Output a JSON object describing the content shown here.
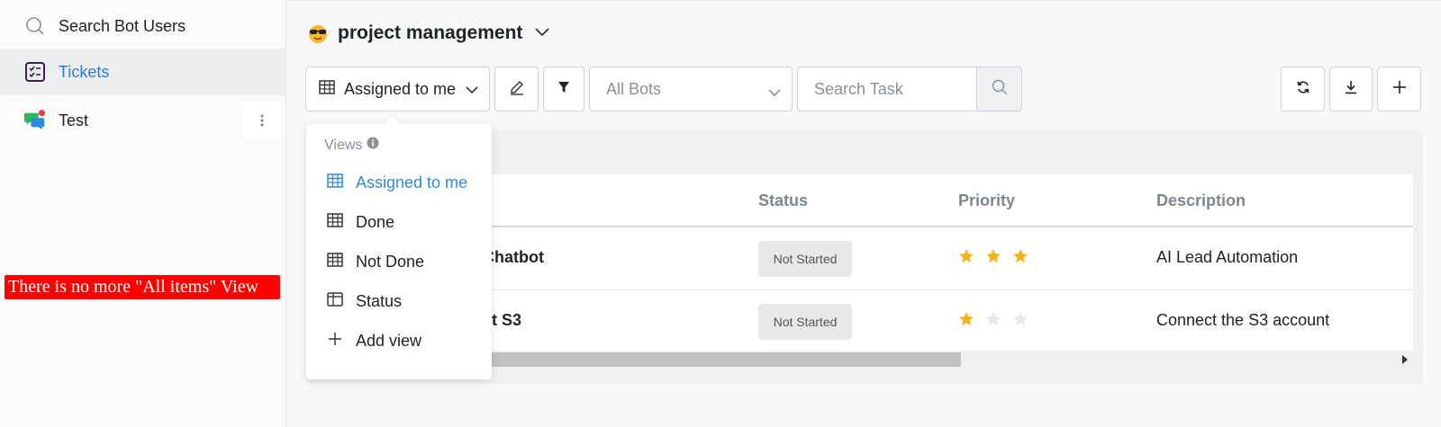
{
  "sidebar": {
    "search_label": "Search Bot Users",
    "tickets_label": "Tickets",
    "test_label": "Test"
  },
  "annotation": "There is no more \"All items\" View",
  "header": {
    "project_title": "project management"
  },
  "toolbar": {
    "view_label": "Assigned to me",
    "bots_label": "All Bots",
    "search_placeholder": "Search Task"
  },
  "views_menu": {
    "heading": "Views",
    "items": [
      "Assigned to me",
      "Done",
      "Not Done",
      "Status",
      "Add view"
    ]
  },
  "table": {
    "columns": {
      "status": "Status",
      "priority": "Priority",
      "description": "Description"
    },
    "rows": [
      {
        "name": "Chatbot",
        "status": "Not Started",
        "priority": 3,
        "description": "AI Lead Automation"
      },
      {
        "name": "ct S3",
        "status": "Not Started",
        "priority": 1,
        "description": "Connect the S3 account"
      }
    ]
  },
  "colors": {
    "accent": "#2b7bd8",
    "star_on": "#f5b31a",
    "star_off": "#e6e7e9",
    "annotation_bg": "#ff0000"
  }
}
